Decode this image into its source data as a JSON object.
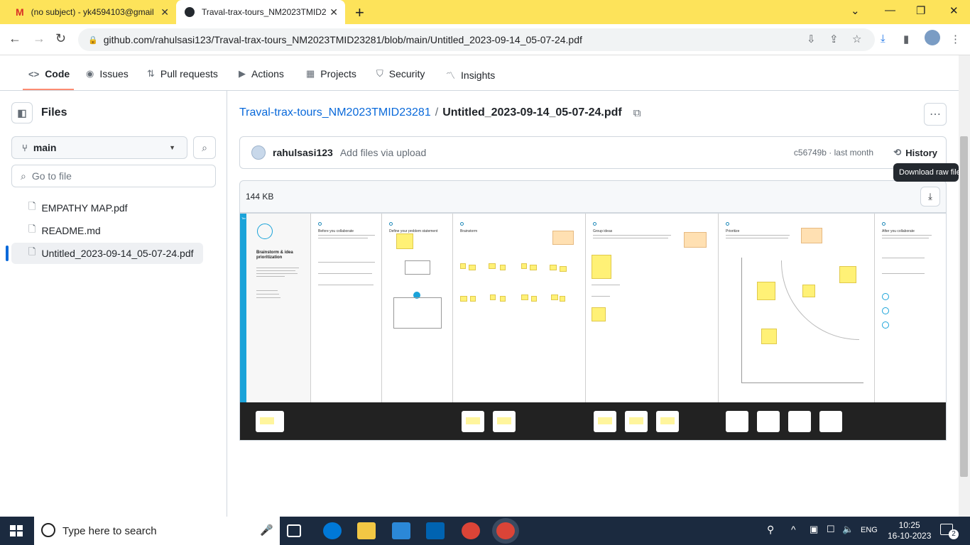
{
  "browser": {
    "tabs": [
      {
        "title": "(no subject) - yk4594103@gmail",
        "icon": "gmail-icon"
      },
      {
        "title": "Traval-trax-tours_NM2023TMID2",
        "icon": "github-icon"
      }
    ],
    "url": "github.com/rahulsasi123/Traval-trax-tours_NM2023TMID23281/blob/main/Untitled_2023-09-14_05-07-24.pdf"
  },
  "repo_nav": {
    "code": "Code",
    "issues": "Issues",
    "pulls": "Pull requests",
    "actions": "Actions",
    "projects": "Projects",
    "security": "Security",
    "insights": "Insights"
  },
  "sidebar": {
    "title": "Files",
    "branch": "main",
    "goto_placeholder": "Go to file",
    "files": [
      {
        "name": "EMPATHY MAP.pdf"
      },
      {
        "name": "README.md"
      },
      {
        "name": "Untitled_2023-09-14_05-07-24.pdf"
      }
    ]
  },
  "breadcrumb": {
    "repo": "Traval-trax-tours_NM2023TMID23281",
    "sep": "/",
    "file": "Untitled_2023-09-14_05-07-24.pdf"
  },
  "commit": {
    "author": "rahulsasi123",
    "message": "Add files via upload",
    "sha_time": "c56749b · last month",
    "history": "History"
  },
  "file": {
    "size": "144  KB",
    "tooltip": "Download raw file"
  },
  "pdf_preview": {
    "cover_title": "Brainstorm & idea prioritization",
    "cover_label": "Template",
    "panels": [
      "Before you collaborate",
      "Define your problem statement",
      "Brainstorm",
      "Group ideas",
      "Prioritize",
      "After you collaborate"
    ]
  },
  "taskbar": {
    "search_placeholder": "Type here to search",
    "lang": "ENG",
    "time": "10:25",
    "date": "16-10-2023",
    "notifications": "2"
  },
  "colors": {
    "accent": "#0969da",
    "tab_underline": "#fd8c73",
    "browser_frame": "#fde35a",
    "sticky": "#fff176"
  }
}
